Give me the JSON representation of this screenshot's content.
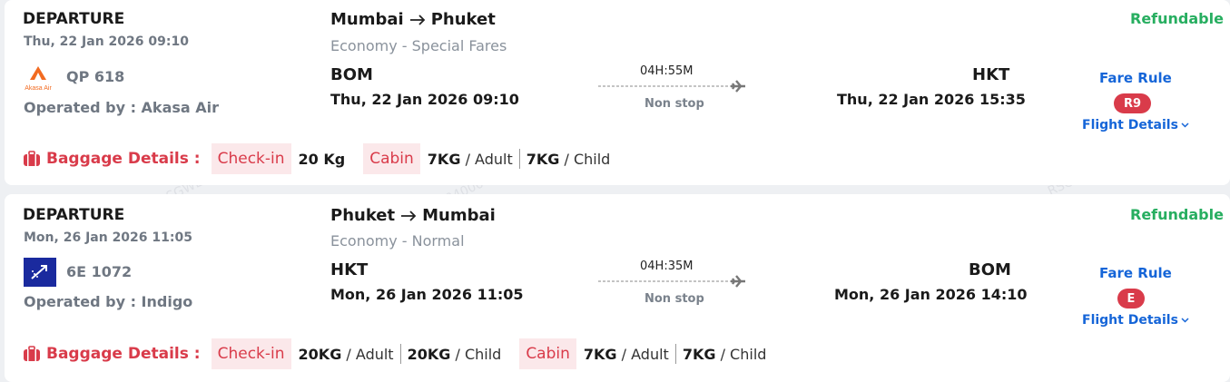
{
  "flights": [
    {
      "direction": "DEPARTURE",
      "dep_datetime": "Thu, 22 Jan 2026 09:10",
      "flight_no": "QP 618",
      "airline_logo_text": "Akasa Air",
      "operated_by": "Operated by : Akasa Air",
      "origin_city": "Mumbai",
      "dest_city": "Phuket",
      "fare_class": "Economy - Special Fares",
      "origin_code": "BOM",
      "origin_time": "Thu, 22 Jan 2026 09:10",
      "duration": "04H:55M",
      "stops": "Non stop",
      "dest_code": "HKT",
      "dest_time": "Thu, 22 Jan 2026 15:35",
      "refund_status": "Refundable",
      "fare_rule_label": "Fare Rule",
      "fare_code": "R9",
      "flight_details_label": "Flight Details",
      "baggage_label": "Baggage Details :",
      "checkin_label": "Check-in",
      "checkin_value": "20 Kg",
      "cabin_label": "Cabin",
      "cabin_adult_value": "7KG",
      "cabin_adult_unit": "/ Adult",
      "cabin_child_value": "7KG",
      "cabin_child_unit": "/ Child"
    },
    {
      "direction": "DEPARTURE",
      "dep_datetime": "Mon, 26 Jan 2026 11:05",
      "flight_no": "6E 1072",
      "operated_by": "Operated by : Indigo",
      "origin_city": "Phuket",
      "dest_city": "Mumbai",
      "fare_class": "Economy - Normal",
      "origin_code": "HKT",
      "origin_time": "Mon, 26 Jan 2026 11:05",
      "duration": "04H:35M",
      "stops": "Non stop",
      "dest_code": "BOM",
      "dest_time": "Mon, 26 Jan 2026 14:10",
      "refund_status": "Refundable",
      "fare_rule_label": "Fare Rule",
      "fare_code": "E",
      "flight_details_label": "Flight Details",
      "baggage_label": "Baggage Details :",
      "checkin_label": "Check-in",
      "checkin_adult_value": "20KG",
      "checkin_adult_unit": "/ Adult",
      "checkin_child_value": "20KG",
      "checkin_child_unit": "/ Child",
      "cabin_label": "Cabin",
      "cabin_adult_value": "7KG",
      "cabin_adult_unit": "/ Adult",
      "cabin_child_value": "7KG",
      "cabin_child_unit": "/ Child"
    }
  ],
  "watermark": "RSGWL0400005",
  "colors": {
    "accent_red": "#d93b4a",
    "link_blue": "#1565d8",
    "refund_green": "#27ae60",
    "akasa_orange": "#f26b21",
    "indigo_blue": "#1a2a9e"
  },
  "icons": [
    "airline-logo",
    "arrow-right-icon",
    "airplane-icon",
    "luggage-icon",
    "chevron-down-icon"
  ]
}
